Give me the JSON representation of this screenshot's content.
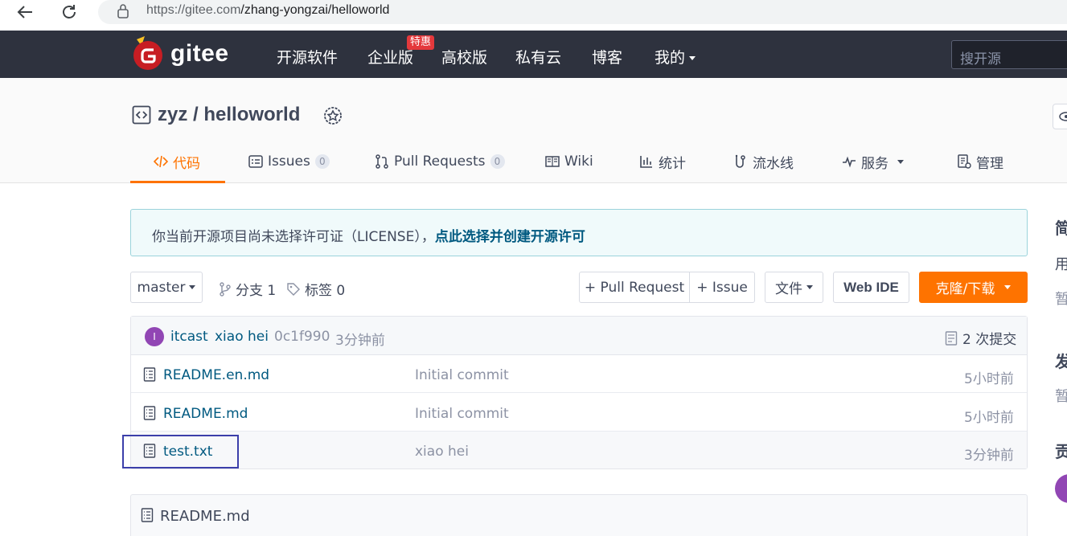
{
  "browser": {
    "url_host": "https://gitee.com",
    "url_path": "/zhang-yongzai/helloworld"
  },
  "header": {
    "logo_text": "gitee",
    "nav": [
      "开源软件",
      "企业版",
      "高校版",
      "私有云",
      "博客",
      "我的"
    ],
    "enterprise_badge": "特惠",
    "search_placeholder": "搜开源"
  },
  "repo": {
    "title": "zyz / helloworld",
    "tabs": [
      {
        "label": "代码"
      },
      {
        "label": "Issues",
        "count": "0"
      },
      {
        "label": "Pull Requests",
        "count": "0"
      },
      {
        "label": "Wiki"
      },
      {
        "label": "统计"
      },
      {
        "label": "流水线"
      },
      {
        "label": "服务"
      },
      {
        "label": "管理"
      }
    ]
  },
  "notice": {
    "text": "你当前开源项目尚未选择许可证（LICENSE），",
    "link": "点此选择并创建开源许可"
  },
  "toolbar": {
    "branch": "master",
    "branches": "分支 1",
    "tags": "标签 0",
    "pull_request": "+ Pull Request",
    "issue": "+ Issue",
    "files": "文件",
    "web_ide": "Web IDE",
    "clone": "克隆/下载"
  },
  "commit": {
    "avatar_letter": "I",
    "author": "itcast",
    "message": "xiao hei",
    "hash": "0c1f990",
    "time": "3分钟前",
    "commit_count": "2 次提交"
  },
  "files": [
    {
      "name": "README.en.md",
      "message": "Initial commit",
      "time": "5小时前"
    },
    {
      "name": "README.md",
      "message": "Initial commit",
      "time": "5小时前"
    },
    {
      "name": "test.txt",
      "message": "xiao hei",
      "time": "3分钟前"
    }
  ],
  "readme": {
    "title": "README.md"
  },
  "sidebar": {
    "heading1": "简",
    "line1": "用",
    "line2": "暂",
    "heading2": "发",
    "line3": "暂",
    "heading3": "贡"
  },
  "colors": {
    "accent": "#fe7300",
    "header_bg": "#2e323e",
    "link": "#005980"
  }
}
